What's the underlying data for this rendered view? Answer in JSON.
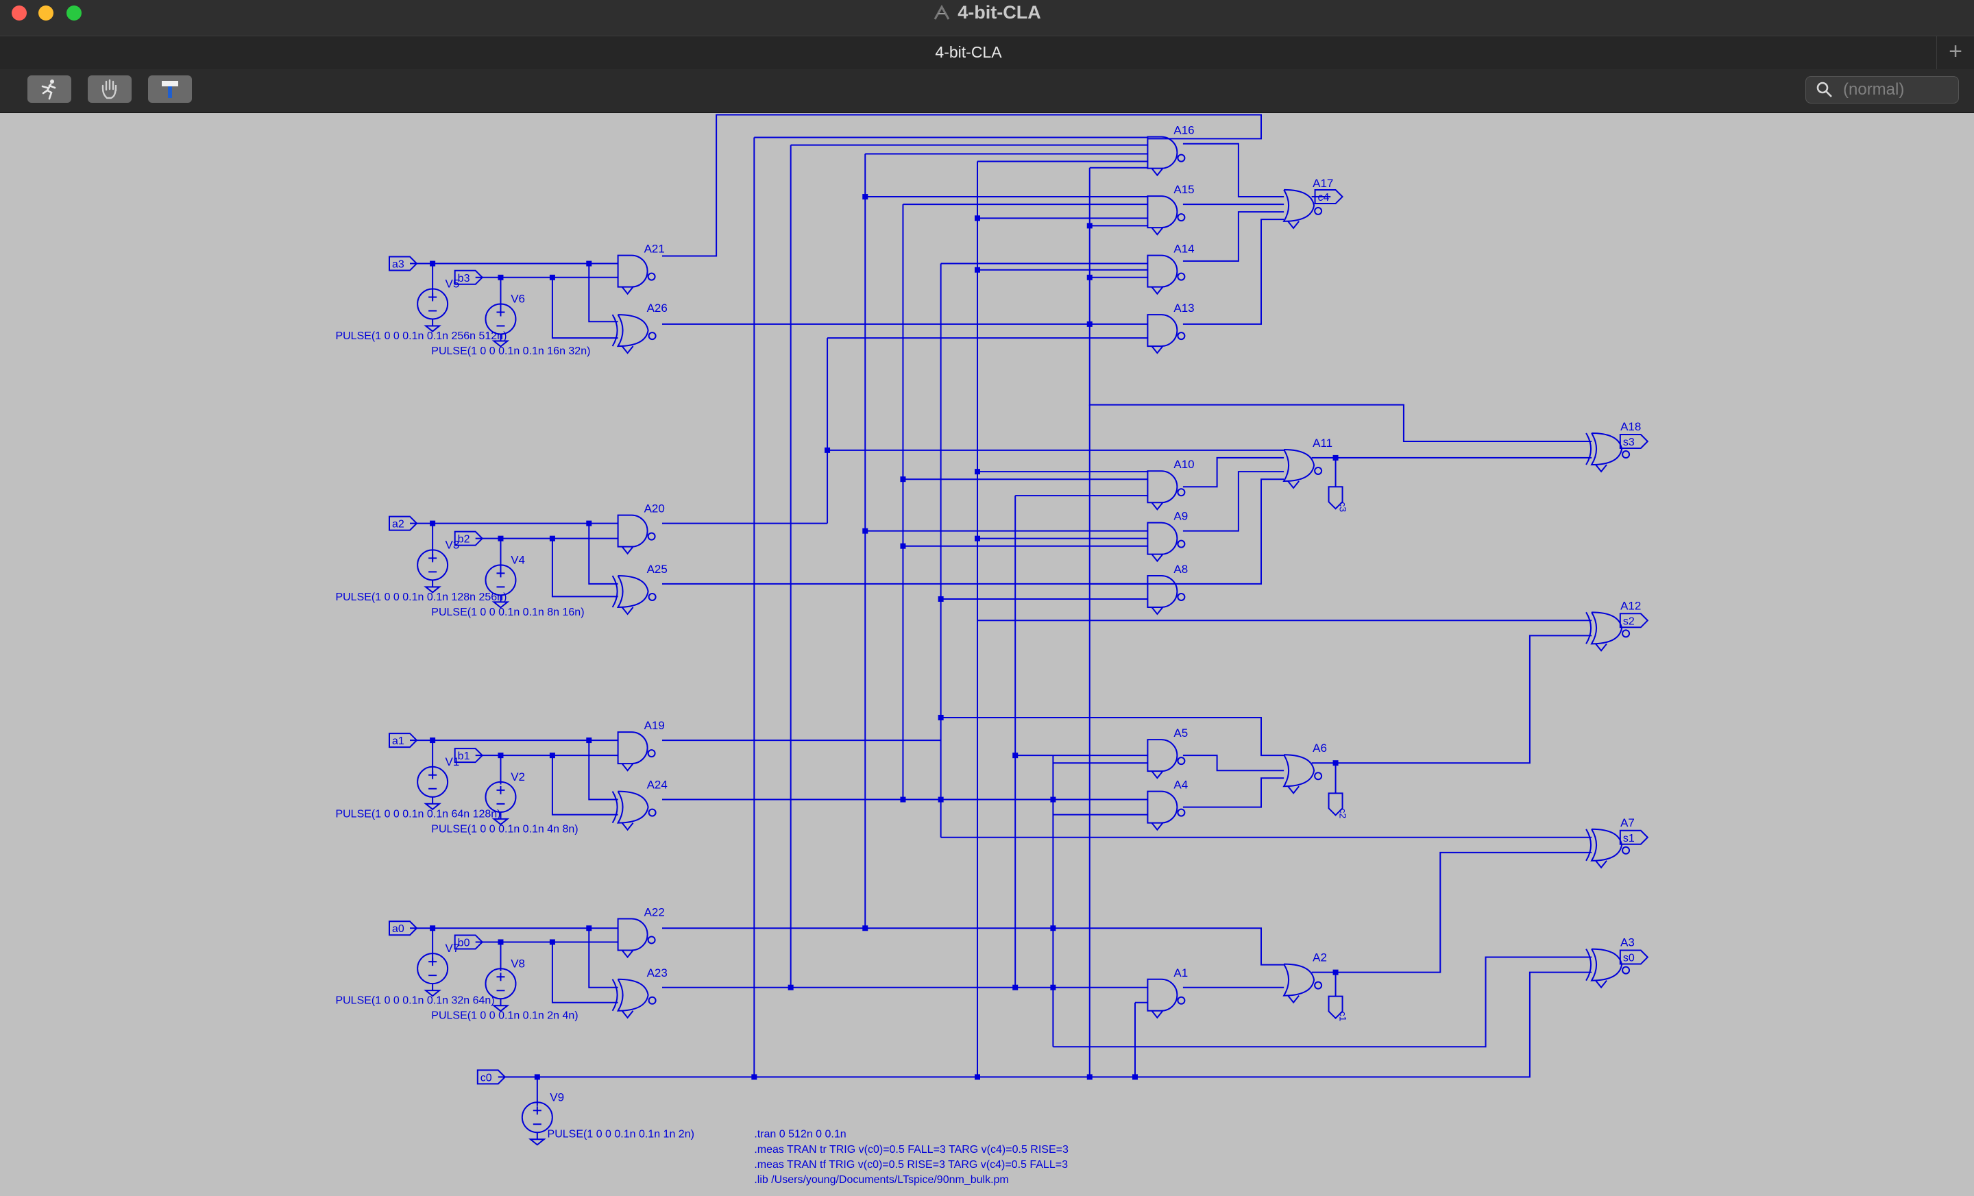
{
  "window": {
    "title": "4-bit-CLA"
  },
  "tabs": [
    {
      "label": "4-bit-CLA"
    }
  ],
  "toolbar": {
    "search_placeholder": "(normal)"
  },
  "schematic": {
    "gates": [
      {
        "id": "A1",
        "kind": "and"
      },
      {
        "id": "A2",
        "kind": "or"
      },
      {
        "id": "A3",
        "kind": "xor"
      },
      {
        "id": "A4",
        "kind": "and"
      },
      {
        "id": "A5",
        "kind": "and"
      },
      {
        "id": "A6",
        "kind": "or"
      },
      {
        "id": "A7",
        "kind": "xor"
      },
      {
        "id": "A8",
        "kind": "and"
      },
      {
        "id": "A9",
        "kind": "and"
      },
      {
        "id": "A10",
        "kind": "and"
      },
      {
        "id": "A11",
        "kind": "or"
      },
      {
        "id": "A12",
        "kind": "xor"
      },
      {
        "id": "A13",
        "kind": "and"
      },
      {
        "id": "A14",
        "kind": "and"
      },
      {
        "id": "A15",
        "kind": "and"
      },
      {
        "id": "A16",
        "kind": "and"
      },
      {
        "id": "A17",
        "kind": "or"
      },
      {
        "id": "A18",
        "kind": "xor"
      },
      {
        "id": "A19",
        "kind": "and"
      },
      {
        "id": "A20",
        "kind": "and"
      },
      {
        "id": "A21",
        "kind": "and"
      },
      {
        "id": "A22",
        "kind": "and"
      },
      {
        "id": "A23",
        "kind": "xor"
      },
      {
        "id": "A24",
        "kind": "xor"
      },
      {
        "id": "A25",
        "kind": "xor"
      },
      {
        "id": "A26",
        "kind": "xor"
      }
    ],
    "input_flags": [
      "a3",
      "b3",
      "a2",
      "b2",
      "a1",
      "b1",
      "a0",
      "b0",
      "c0"
    ],
    "output_flags": [
      "c4",
      "s3",
      "c3",
      "s2",
      "c2",
      "s1",
      "c1",
      "s0"
    ],
    "sources": [
      {
        "name": "V5",
        "pulse": "PULSE(1 0 0 0.1n 0.1n 256n 512n)"
      },
      {
        "name": "V6",
        "pulse": "PULSE(1 0 0 0.1n 0.1n 16n 32n)"
      },
      {
        "name": "V3",
        "pulse": "PULSE(1 0 0 0.1n 0.1n 128n 256n)"
      },
      {
        "name": "V4",
        "pulse": "PULSE(1 0 0 0.1n 0.1n 8n 16n)"
      },
      {
        "name": "V1",
        "pulse": "PULSE(1 0 0 0.1n 0.1n 64n 128n)"
      },
      {
        "name": "V2",
        "pulse": "PULSE(1 0 0 0.1n 0.1n 4n 8n)"
      },
      {
        "name": "V7",
        "pulse": "PULSE(1 0 0 0.1n 0.1n 32n 64n)"
      },
      {
        "name": "V8",
        "pulse": "PULSE(1 0 0 0.1n 0.1n 2n 4n)"
      },
      {
        "name": "V9",
        "pulse": "PULSE(1 0 0 0.1n 0.1n 1n 2n)"
      }
    ],
    "directives": [
      ".tran 0 512n 0 0.1n",
      ".meas TRAN tr TRIG v(c0)=0.5 FALL=3 TARG v(c4)=0.5 RISE=3",
      ".meas TRAN tf TRIG v(c0)=0.5 RISE=3 TARG v(c4)=0.5 FALL=3",
      ".lib /Users/young/Documents/LTspice/90nm_bulk.pm"
    ]
  },
  "colors": {
    "wire": "#0000d8",
    "background": "#c0c0c0"
  }
}
